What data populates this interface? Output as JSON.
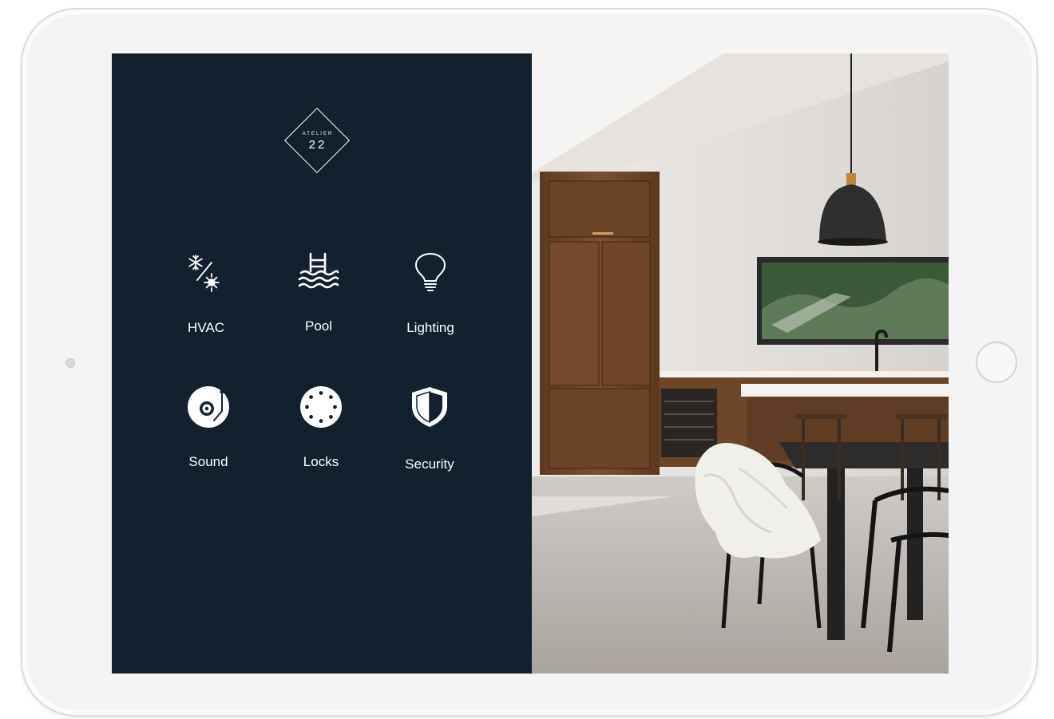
{
  "brand": {
    "name_top": "ATELIER",
    "name_number": "22"
  },
  "tiles": [
    {
      "id": "hvac",
      "label": "HVAC",
      "icon": "hvac-icon"
    },
    {
      "id": "pool",
      "label": "Pool",
      "icon": "pool-icon"
    },
    {
      "id": "lighting",
      "label": "Lighting",
      "icon": "lightbulb-icon"
    },
    {
      "id": "sound",
      "label": "Sound",
      "icon": "turntable-icon"
    },
    {
      "id": "locks",
      "label": "Locks",
      "icon": "lock-dial-icon"
    },
    {
      "id": "security",
      "label": "Security",
      "icon": "shield-icon"
    }
  ],
  "colors": {
    "panel_background": "#13212e",
    "icon_color": "#ffffff",
    "text_color": "#ffffff",
    "device_frame": "#f4f4f5"
  }
}
